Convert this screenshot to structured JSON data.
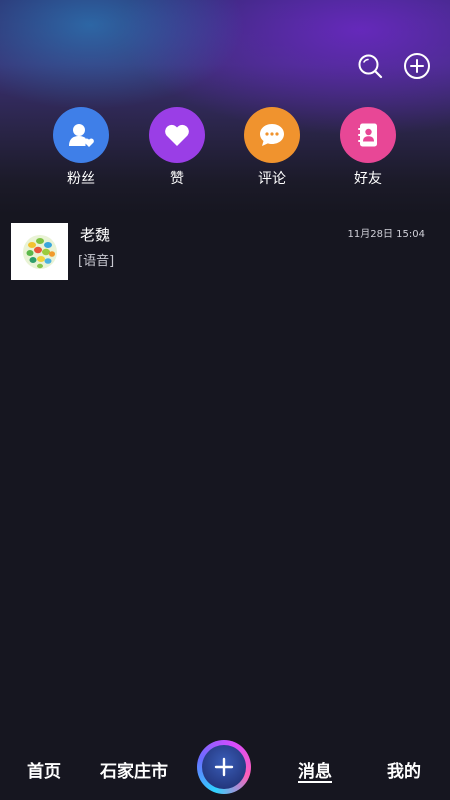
{
  "header": {
    "search_icon": "search-icon",
    "add_icon": "add-circle-icon"
  },
  "quick_actions": [
    {
      "label": "粉丝",
      "icon": "fans-icon",
      "color": "#3f7fe8"
    },
    {
      "label": "赞",
      "icon": "heart-icon",
      "color": "#9a3ee6"
    },
    {
      "label": "评论",
      "icon": "comment-icon",
      "color": "#f0932e"
    },
    {
      "label": "好友",
      "icon": "contacts-icon",
      "color": "#e84796"
    }
  ],
  "messages": [
    {
      "name": "老魏",
      "preview": "[语音]",
      "time": "11月28日 15:04",
      "avatar_icon": "leaf-sphere-icon"
    }
  ],
  "tabbar": {
    "home": "首页",
    "city": "石家庄市",
    "center_icon": "plus-icon",
    "messages": "消息",
    "me": "我的",
    "active": "消息"
  }
}
